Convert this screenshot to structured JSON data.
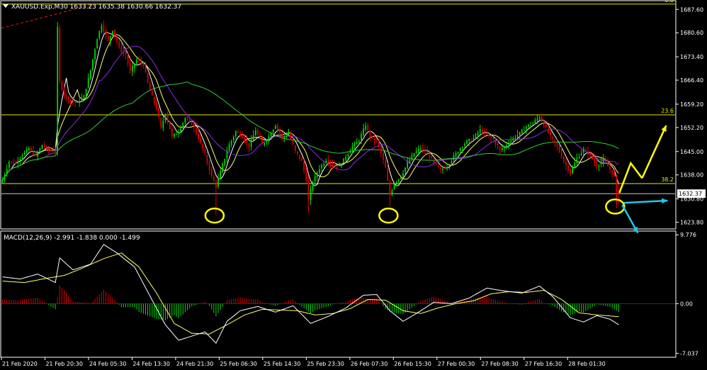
{
  "window": {
    "symbol_header": "XAUUSD.Exp,M30  1633.23 1635.38 1630.66 1632.37",
    "macd_header": "MACD(12,26,9) -2.991 -1.838 0.000 -1.499"
  },
  "colors": {
    "background": "#000000",
    "bull_candle": "#00e000",
    "bear_candle": "#e00000",
    "frame": "#ffffff",
    "fib_line": "#e6e600",
    "current_price_line": "#c8c8c8",
    "ma_fast": "#ffffff",
    "ma_mid": "#ffff66",
    "ma_slow": "#8a2be2",
    "ma_long": "#32cd32",
    "trendline": "#e02020",
    "macd_signal": "#ffff66",
    "macd_main": "#ffffff",
    "annotation_circle": "#ffff00",
    "arrow_up": "#ffff00",
    "arrow_side": "#20c8e8"
  },
  "chart_data": [
    {
      "type": "candlestick",
      "symbol": "XAUUSD.Exp",
      "timeframe": "M30",
      "ohlc_last": {
        "open": 1633.23,
        "high": 1635.38,
        "low": 1630.66,
        "close": 1632.37
      },
      "current_price_label": "1632.37",
      "ylim": [
        1622.0,
        1690.0
      ],
      "y_ticks": [
        1687.6,
        1680.6,
        1673.4,
        1666.4,
        1659.2,
        1652.2,
        1645.0,
        1638.0,
        1630.8,
        1623.8
      ],
      "y_tick_labels": [
        "1687.60",
        "1680.60",
        "1673.40",
        "1666.40",
        "1659.20",
        "1652.20",
        "1645.00",
        "1638.00",
        "1630.80",
        "1623.80"
      ],
      "x_tick_labels": [
        "21 Feb 2020",
        "21 Feb 20:30",
        "24 Feb 05:30",
        "24 Feb 13:30",
        "24 Feb 21:30",
        "25 Feb 06:30",
        "25 Feb 14:30",
        "25 Feb 23:30",
        "26 Feb 07:30",
        "26 Feb 15:30",
        "27 Feb 00:30",
        "27 Feb 08:30",
        "27 Feb 16:30",
        "28 Feb 01:30"
      ],
      "fibonacci_levels": [
        {
          "label": "0.0",
          "price": 1689.2
        },
        {
          "label": "23.6",
          "price": 1656.0
        },
        {
          "label": "38.2",
          "price": 1635.4
        }
      ],
      "close_path": [
        [
          0,
          1636.5
        ],
        [
          3,
          1642.0
        ],
        [
          6,
          1641.5
        ],
        [
          9,
          1644.0
        ],
        [
          12,
          1646.0
        ],
        [
          15,
          1643.5
        ],
        [
          18,
          1647.0
        ],
        [
          21,
          1645.5
        ],
        [
          24,
          1645.0
        ],
        [
          25,
          1682.0
        ],
        [
          26,
          1666.0
        ],
        [
          28,
          1662.0
        ],
        [
          31,
          1660.0
        ],
        [
          34,
          1659.5
        ],
        [
          37,
          1661.5
        ],
        [
          40,
          1669.5
        ],
        [
          43,
          1679.0
        ],
        [
          45,
          1683.0
        ],
        [
          48,
          1678.0
        ],
        [
          50,
          1681.5
        ],
        [
          53,
          1676.0
        ],
        [
          56,
          1674.0
        ],
        [
          58,
          1669.0
        ],
        [
          61,
          1672.5
        ],
        [
          64,
          1671.0
        ],
        [
          67,
          1663.0
        ],
        [
          70,
          1658.0
        ],
        [
          72,
          1652.0
        ],
        [
          74,
          1656.5
        ],
        [
          77,
          1649.5
        ],
        [
          80,
          1651.0
        ],
        [
          83,
          1655.0
        ],
        [
          86,
          1653.5
        ],
        [
          89,
          1649.0
        ],
        [
          92,
          1644.0
        ],
        [
          95,
          1637.5
        ],
        [
          97,
          1634.5
        ],
        [
          100,
          1641.0
        ],
        [
          103,
          1647.0
        ],
        [
          106,
          1651.0
        ],
        [
          109,
          1649.5
        ],
        [
          112,
          1646.5
        ],
        [
          115,
          1651.5
        ],
        [
          118,
          1647.0
        ],
        [
          121,
          1649.5
        ],
        [
          124,
          1653.0
        ],
        [
          127,
          1649.0
        ],
        [
          130,
          1650.5
        ],
        [
          133,
          1645.0
        ],
        [
          136,
          1642.0
        ],
        [
          138,
          1636.5
        ],
        [
          139,
          1630.5
        ],
        [
          141,
          1636.0
        ],
        [
          144,
          1640.0
        ],
        [
          147,
          1642.5
        ],
        [
          150,
          1641.0
        ],
        [
          153,
          1640.5
        ],
        [
          156,
          1643.5
        ],
        [
          159,
          1646.5
        ],
        [
          162,
          1648.5
        ],
        [
          165,
          1653.0
        ],
        [
          167,
          1649.5
        ],
        [
          170,
          1648.0
        ],
        [
          172,
          1644.5
        ],
        [
          174,
          1640.0
        ],
        [
          176,
          1632.0
        ],
        [
          178,
          1635.5
        ],
        [
          181,
          1637.5
        ],
        [
          184,
          1641.5
        ],
        [
          187,
          1644.5
        ],
        [
          190,
          1646.0
        ],
        [
          193,
          1644.5
        ],
        [
          196,
          1641.5
        ],
        [
          199,
          1639.5
        ],
        [
          202,
          1640.5
        ],
        [
          205,
          1643.5
        ],
        [
          208,
          1646.0
        ],
        [
          211,
          1648.0
        ],
        [
          214,
          1649.0
        ],
        [
          217,
          1651.5
        ],
        [
          220,
          1650.0
        ],
        [
          223,
          1648.5
        ],
        [
          226,
          1645.5
        ],
        [
          229,
          1647.0
        ],
        [
          232,
          1649.0
        ],
        [
          235,
          1650.5
        ],
        [
          238,
          1652.5
        ],
        [
          241,
          1653.5
        ],
        [
          244,
          1655.5
        ],
        [
          246,
          1653.0
        ],
        [
          249,
          1649.5
        ],
        [
          252,
          1646.5
        ],
        [
          255,
          1642.0
        ],
        [
          258,
          1638.5
        ],
        [
          261,
          1643.0
        ],
        [
          264,
          1645.5
        ],
        [
          267,
          1644.0
        ],
        [
          270,
          1640.5
        ],
        [
          273,
          1642.5
        ],
        [
          276,
          1639.5
        ],
        [
          278,
          1637.5
        ],
        [
          279,
          1629.0
        ],
        [
          280,
          1632.37
        ]
      ],
      "annotations": [
        "circle at low near 25 Feb 14:30",
        "circle at low near 26 Feb 07:30",
        "circle at latest candle low",
        "yellow arrow up toward 23.6 level",
        "cyan arrow right at 1630 level",
        "cyan arrow down"
      ]
    },
    {
      "type": "macd",
      "params": "12,26,9",
      "values": {
        "main": -2.991,
        "signal": -1.838,
        "level": 0.0,
        "histogram": -1.499
      },
      "ylim": [
        -7.5,
        10.2
      ],
      "y_tick_labels": [
        "9.776",
        "0.00",
        "-7.037"
      ],
      "main_path": [
        [
          0,
          3.8
        ],
        [
          8,
          3.5
        ],
        [
          16,
          4.2
        ],
        [
          24,
          3.0
        ],
        [
          26,
          6.5
        ],
        [
          32,
          4.8
        ],
        [
          40,
          5.6
        ],
        [
          46,
          8.4
        ],
        [
          52,
          7.2
        ],
        [
          60,
          5.2
        ],
        [
          68,
          0.5
        ],
        [
          74,
          -3.0
        ],
        [
          80,
          -5.2
        ],
        [
          86,
          -4.6
        ],
        [
          92,
          -4.0
        ],
        [
          97,
          -5.6
        ],
        [
          102,
          -2.5
        ],
        [
          108,
          -1.0
        ],
        [
          116,
          -0.4
        ],
        [
          124,
          -1.2
        ],
        [
          132,
          -0.3
        ],
        [
          140,
          -2.8
        ],
        [
          148,
          -1.8
        ],
        [
          156,
          -0.6
        ],
        [
          164,
          1.2
        ],
        [
          170,
          1.3
        ],
        [
          176,
          -1.0
        ],
        [
          182,
          -2.5
        ],
        [
          188,
          -1.4
        ],
        [
          196,
          0.2
        ],
        [
          204,
          0.0
        ],
        [
          212,
          0.8
        ],
        [
          220,
          2.2
        ],
        [
          228,
          1.8
        ],
        [
          236,
          1.5
        ],
        [
          244,
          2.5
        ],
        [
          250,
          1.0
        ],
        [
          258,
          -2.0
        ],
        [
          264,
          -2.6
        ],
        [
          270,
          -1.7
        ],
        [
          276,
          -2.2
        ],
        [
          280,
          -2.991
        ]
      ],
      "signal_path": [
        [
          0,
          3.2
        ],
        [
          10,
          3.0
        ],
        [
          20,
          3.6
        ],
        [
          28,
          4.0
        ],
        [
          36,
          5.0
        ],
        [
          46,
          6.4
        ],
        [
          54,
          7.2
        ],
        [
          62,
          5.2
        ],
        [
          70,
          1.5
        ],
        [
          78,
          -2.8
        ],
        [
          86,
          -4.2
        ],
        [
          94,
          -4.3
        ],
        [
          102,
          -3.0
        ],
        [
          110,
          -1.6
        ],
        [
          118,
          -0.8
        ],
        [
          126,
          -0.9
        ],
        [
          134,
          -1.0
        ],
        [
          142,
          -1.6
        ],
        [
          150,
          -1.4
        ],
        [
          158,
          -0.7
        ],
        [
          166,
          0.6
        ],
        [
          174,
          0.5
        ],
        [
          182,
          -1.0
        ],
        [
          190,
          -1.4
        ],
        [
          198,
          -0.6
        ],
        [
          206,
          0.0
        ],
        [
          214,
          0.4
        ],
        [
          222,
          1.4
        ],
        [
          230,
          1.7
        ],
        [
          238,
          1.6
        ],
        [
          246,
          1.9
        ],
        [
          254,
          0.6
        ],
        [
          262,
          -1.3
        ],
        [
          270,
          -1.6
        ],
        [
          280,
          -1.838
        ]
      ]
    }
  ]
}
